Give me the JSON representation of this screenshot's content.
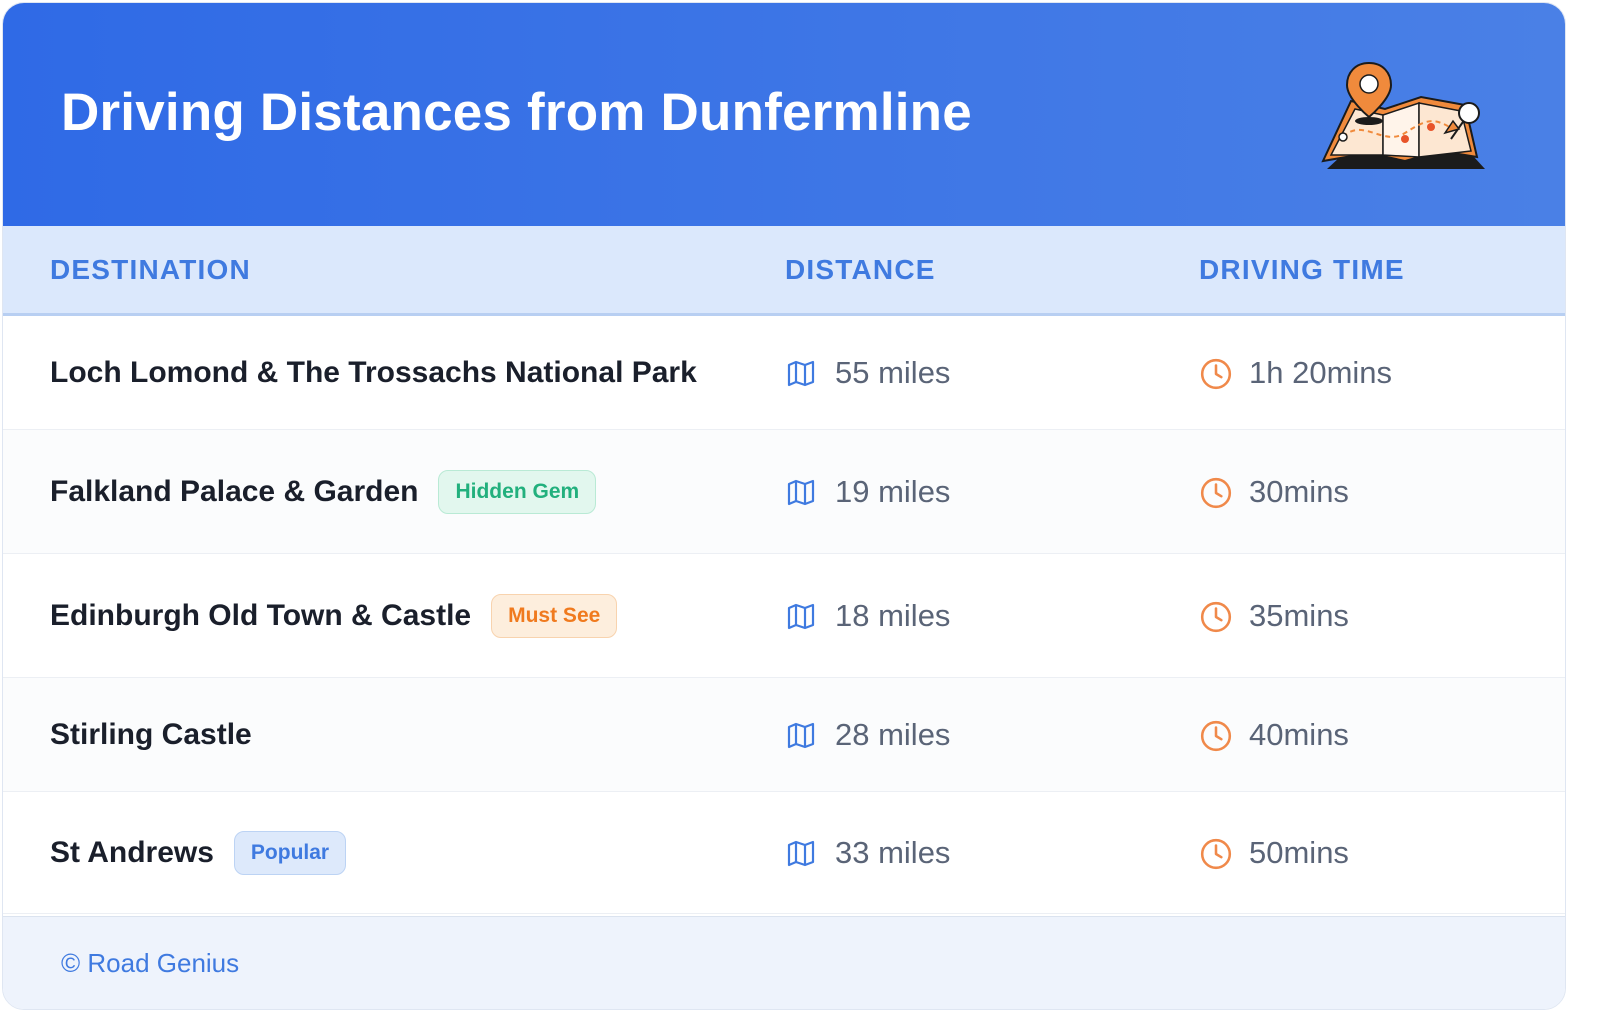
{
  "header": {
    "title": "Driving Distances from Dunfermline"
  },
  "table": {
    "columns": [
      "DESTINATION",
      "DISTANCE",
      "DRIVING TIME"
    ],
    "rows": [
      {
        "destination": "Loch Lomond & The Trossachs National Park",
        "badge": "",
        "badge_type": "",
        "distance": "55 miles",
        "time": "1h 20mins"
      },
      {
        "destination": "Falkland Palace & Garden",
        "badge": "Hidden Gem",
        "badge_type": "green",
        "distance": "19 miles",
        "time": "30mins"
      },
      {
        "destination": "Edinburgh Old Town & Castle",
        "badge": "Must See",
        "badge_type": "orange",
        "distance": "18 miles",
        "time": "35mins"
      },
      {
        "destination": "Stirling Castle",
        "badge": "",
        "badge_type": "",
        "distance": "28 miles",
        "time": "40mins"
      },
      {
        "destination": "St Andrews",
        "badge": "Popular",
        "badge_type": "blue",
        "distance": "33 miles",
        "time": "50mins"
      }
    ]
  },
  "footer": {
    "credit": "© Road Genius"
  },
  "icons": {
    "distance": "map-icon",
    "time": "clock-icon",
    "header": "map-pin-illustration"
  },
  "colors": {
    "header_start": "#2f6ae6",
    "header_end": "#4a80e6",
    "accent_blue": "#3f7ae0",
    "clock_orange": "#f0894a",
    "badge_green_text": "#22b07d",
    "badge_green_bg": "#e2f7ee",
    "badge_orange_text": "#f07a1e",
    "badge_orange_bg": "#fdeedd",
    "badge_blue_text": "#3f7ae0",
    "badge_blue_bg": "#dde9fb"
  }
}
